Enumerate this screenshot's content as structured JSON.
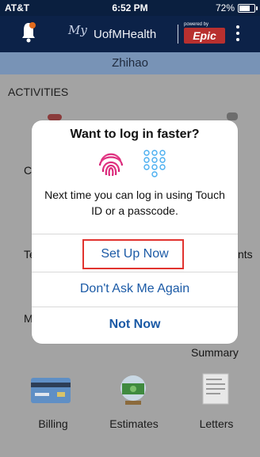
{
  "status": {
    "carrier": "AT&T",
    "time": "6:52 PM",
    "battery": "72%"
  },
  "header": {
    "logo_my": "My",
    "logo_name": "UofMHealth",
    "powered_by": "powered by",
    "epic": "Epic",
    "icons": [
      "bell-icon",
      "more-icon"
    ]
  },
  "user": {
    "name": "Zhihao"
  },
  "section": {
    "title": "ACTIVITIES"
  },
  "background": {
    "partial_labels": [
      "Co",
      "Te",
      "nts",
      "M"
    ],
    "summary": "Summary",
    "tiles": [
      "Billing",
      "Estimates",
      "Letters"
    ]
  },
  "alert": {
    "title": "Want to log in faster?",
    "message": "Next time you can log in using Touch ID or a passcode.",
    "buttons": [
      "Set Up Now",
      "Don't Ask Me Again",
      "Not Now"
    ],
    "icons": [
      "fingerprint-icon",
      "passcode-icon"
    ]
  },
  "colors": {
    "header_bg": "#0c2248",
    "user_bar": "#7893b6",
    "button_text": "#1b5aa6",
    "highlight": "#e1332f",
    "epic": "#b8302f"
  }
}
